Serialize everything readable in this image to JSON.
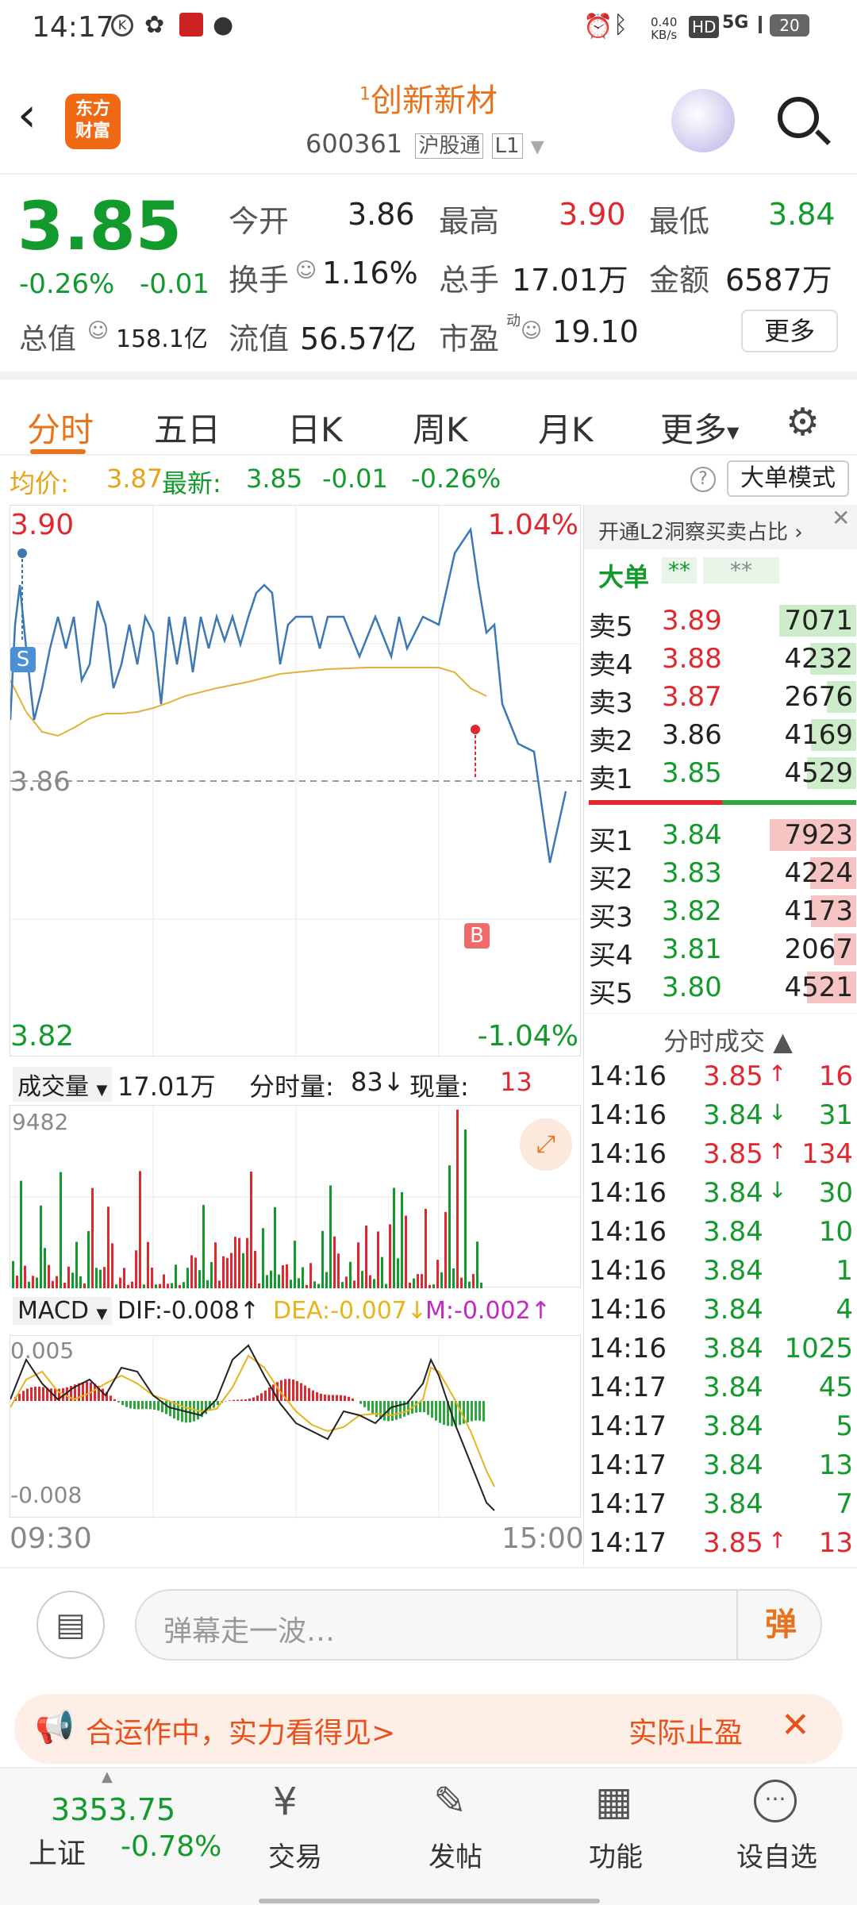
{
  "statusbar": {
    "time": "14:17",
    "net_speed_top": "0.40",
    "net_speed_bottom": "KB/s",
    "hd": "HD",
    "signal": "5G",
    "battery": "20"
  },
  "header": {
    "logo_line1": "东方",
    "logo_line2": "财富",
    "title_prefix": "1",
    "title": "创新新材",
    "code": "600361",
    "market": "沪股通",
    "level": "L1"
  },
  "quote": {
    "price": "3.85",
    "change_pct": "-0.26%",
    "change": "-0.01",
    "open_label": "今开",
    "open": "3.86",
    "high_label": "最高",
    "high": "3.90",
    "low_label": "最低",
    "low": "3.84",
    "turnover_label": "换手",
    "turnover": "1.16%",
    "volume_label": "总手",
    "volume": "17.01万",
    "amount_label": "金额",
    "amount": "6587万",
    "mcap_label": "总值",
    "mcap": "158.1亿",
    "float_label": "流值",
    "float": "56.57亿",
    "pe_label": "市盈",
    "pe_sup": "动",
    "pe": "19.10",
    "more": "更多"
  },
  "tabs": [
    "分时",
    "五日",
    "日K",
    "周K",
    "月K",
    "更多"
  ],
  "infobar": {
    "avg_label": "均价:",
    "avg": "3.87",
    "latest_label": "最新:",
    "latest": "3.85",
    "chg": "-0.01",
    "pct": "-0.26%",
    "mode": "大单模式"
  },
  "chart": {
    "y_top": "3.90",
    "y_top_pct": "1.04%",
    "y_mid": "3.86",
    "y_bot": "3.82",
    "y_bot_pct": "-1.04%",
    "marker_s": "S",
    "marker_b": "B"
  },
  "volume": {
    "label": "成交量",
    "total": "17.01万",
    "tick_label": "分时量:",
    "tick": "83",
    "cur_label": "现量:",
    "cur": "13",
    "max": "9482"
  },
  "macd": {
    "label": "MACD",
    "dif": "DIF:-0.008",
    "dea": "DEA:-0.007",
    "m": "M:-0.002",
    "top": "0.005",
    "bot": "-0.008",
    "t_start": "09:30",
    "t_end": "15:00"
  },
  "book": {
    "promo": "开通L2洞察买卖占比",
    "big": "大单",
    "big_v1": "**",
    "big_v2": "**",
    "asks": [
      {
        "label": "卖5",
        "price": "3.89",
        "vol": "7071"
      },
      {
        "label": "卖4",
        "price": "3.88",
        "vol": "4232"
      },
      {
        "label": "卖3",
        "price": "3.87",
        "vol": "2676"
      },
      {
        "label": "卖2",
        "price": "3.86",
        "vol": "4169"
      },
      {
        "label": "卖1",
        "price": "3.85",
        "vol": "4529"
      }
    ],
    "bids": [
      {
        "label": "买1",
        "price": "3.84",
        "vol": "7923"
      },
      {
        "label": "买2",
        "price": "3.83",
        "vol": "4224"
      },
      {
        "label": "买3",
        "price": "3.82",
        "vol": "4173"
      },
      {
        "label": "买4",
        "price": "3.81",
        "vol": "2067"
      },
      {
        "label": "买5",
        "price": "3.80",
        "vol": "4521"
      }
    ],
    "ticks_title": "分时成交",
    "ticks": [
      {
        "t": "14:16",
        "p": "3.85",
        "a": "↑",
        "v": "16"
      },
      {
        "t": "14:16",
        "p": "3.84",
        "a": "↓",
        "v": "31"
      },
      {
        "t": "14:16",
        "p": "3.85",
        "a": "↑",
        "v": "134"
      },
      {
        "t": "14:16",
        "p": "3.84",
        "a": "↓",
        "v": "30"
      },
      {
        "t": "14:16",
        "p": "3.84",
        "a": "",
        "v": "10"
      },
      {
        "t": "14:16",
        "p": "3.84",
        "a": "",
        "v": "1"
      },
      {
        "t": "14:16",
        "p": "3.84",
        "a": "",
        "v": "4"
      },
      {
        "t": "14:16",
        "p": "3.84",
        "a": "",
        "v": "1025"
      },
      {
        "t": "14:17",
        "p": "3.84",
        "a": "",
        "v": "45"
      },
      {
        "t": "14:17",
        "p": "3.84",
        "a": "",
        "v": "5"
      },
      {
        "t": "14:17",
        "p": "3.84",
        "a": "",
        "v": "13"
      },
      {
        "t": "14:17",
        "p": "3.84",
        "a": "",
        "v": "7"
      },
      {
        "t": "14:17",
        "p": "3.85",
        "a": "↑",
        "v": "13"
      }
    ]
  },
  "comment": {
    "placeholder": "弹幕走一波…",
    "send": "弹"
  },
  "banner": {
    "text": "合运作中，实力看得见>",
    "right": "实际止盈"
  },
  "bottom": {
    "index_value": "3353.75",
    "index_name": "上证",
    "index_pct": "-0.78%",
    "items": [
      "交易",
      "发帖",
      "功能",
      "设自选"
    ]
  }
}
